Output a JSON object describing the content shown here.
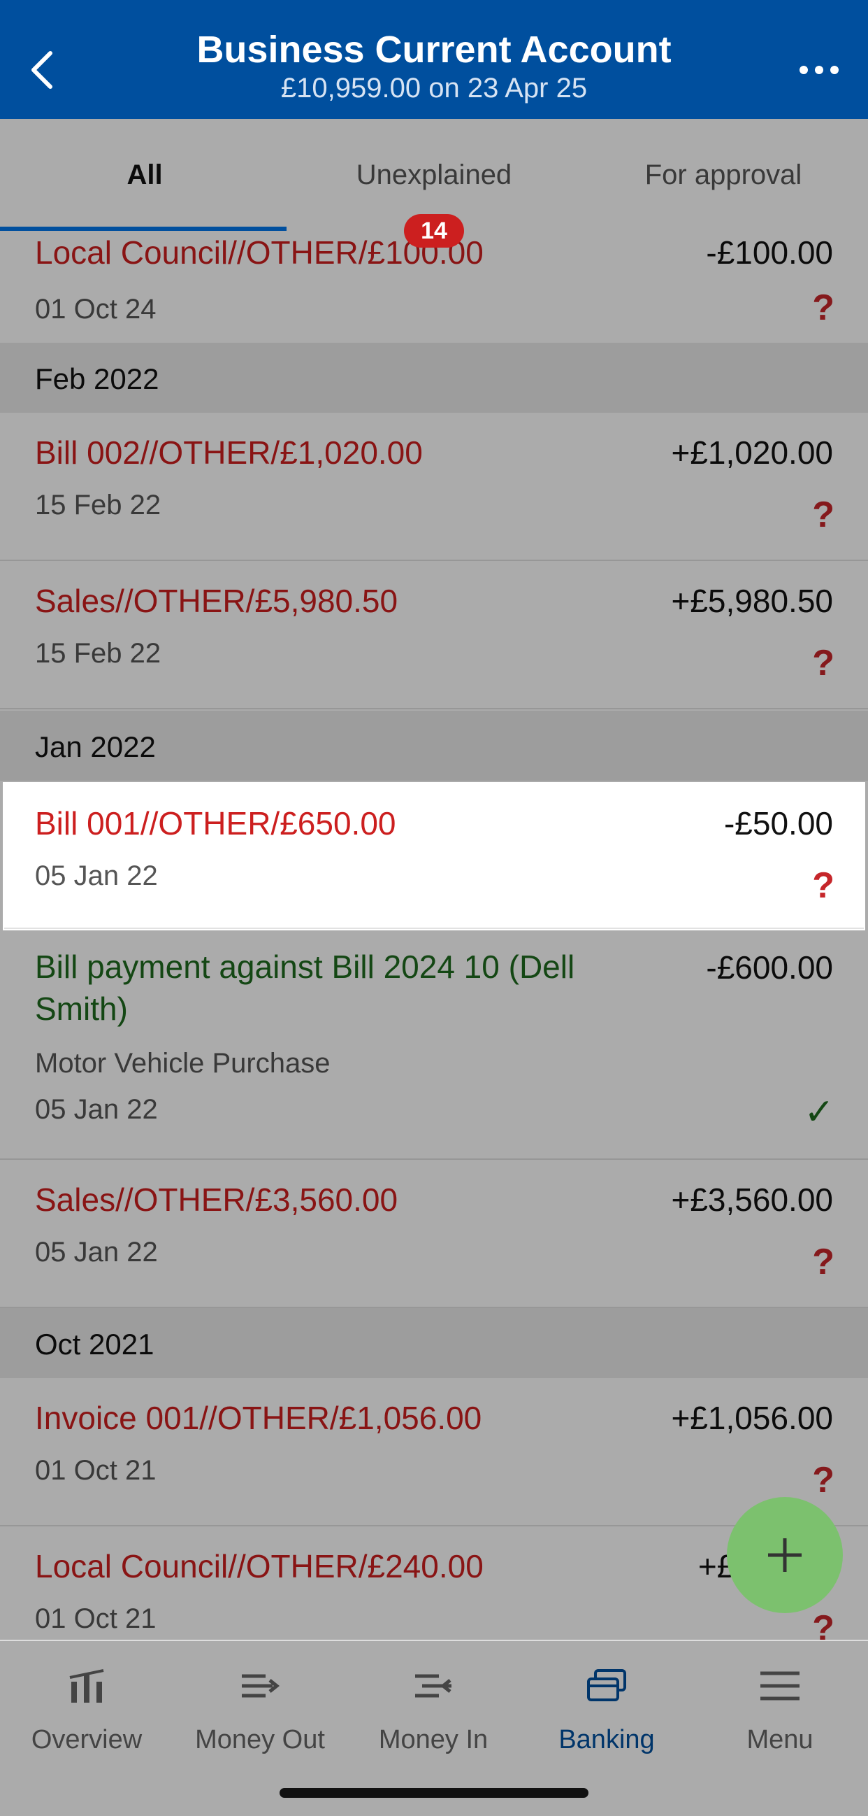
{
  "header": {
    "title": "Business Current Account",
    "subtitle": "£10,959.00 on 23 Apr 25"
  },
  "tabs": [
    {
      "label": "All"
    },
    {
      "label": "Unexplained"
    },
    {
      "label": "For approval"
    }
  ],
  "badge": "14",
  "rows": [
    {
      "desc": "Local Council//OTHER/£100.00",
      "amount": "-£100.00",
      "date": "01 Oct 24"
    },
    {
      "desc": "Bill 002//OTHER/£1,020.00",
      "amount": "+£1,020.00",
      "date": "15 Feb 22"
    },
    {
      "desc": "Sales//OTHER/£5,980.50",
      "amount": "+£5,980.50",
      "date": "15 Feb 22"
    },
    {
      "desc": "Bill 001//OTHER/£650.00",
      "amount": "-£50.00",
      "date": "05 Jan 22"
    },
    {
      "desc": "Bill payment against Bill 2024 10 (Dell Smith)",
      "amount": "-£600.00",
      "category": "Motor Vehicle Purchase",
      "date": "05 Jan 22"
    },
    {
      "desc": "Sales//OTHER/£3,560.00",
      "amount": "+£3,560.00",
      "date": "05 Jan 22"
    },
    {
      "desc": "Invoice 001//OTHER/£1,056.00",
      "amount": "+£1,056.00",
      "date": "01 Oct 21"
    },
    {
      "desc": "Local Council//OTHER/£240.00",
      "amount": "+£240.00",
      "date": "01 Oct 21"
    }
  ],
  "groups": [
    "Feb 2022",
    "Jan 2022",
    "Oct 2021"
  ],
  "status": {
    "unexplained": "?",
    "explained": "✓"
  },
  "nav": [
    {
      "label": "Overview"
    },
    {
      "label": "Money Out"
    },
    {
      "label": "Money In"
    },
    {
      "label": "Banking"
    },
    {
      "label": "Menu"
    }
  ],
  "colors": {
    "brand": "#004f9e",
    "unexplained": "#cc1f1f",
    "explained": "#1f6b1f",
    "fab": "#7cc16e"
  }
}
